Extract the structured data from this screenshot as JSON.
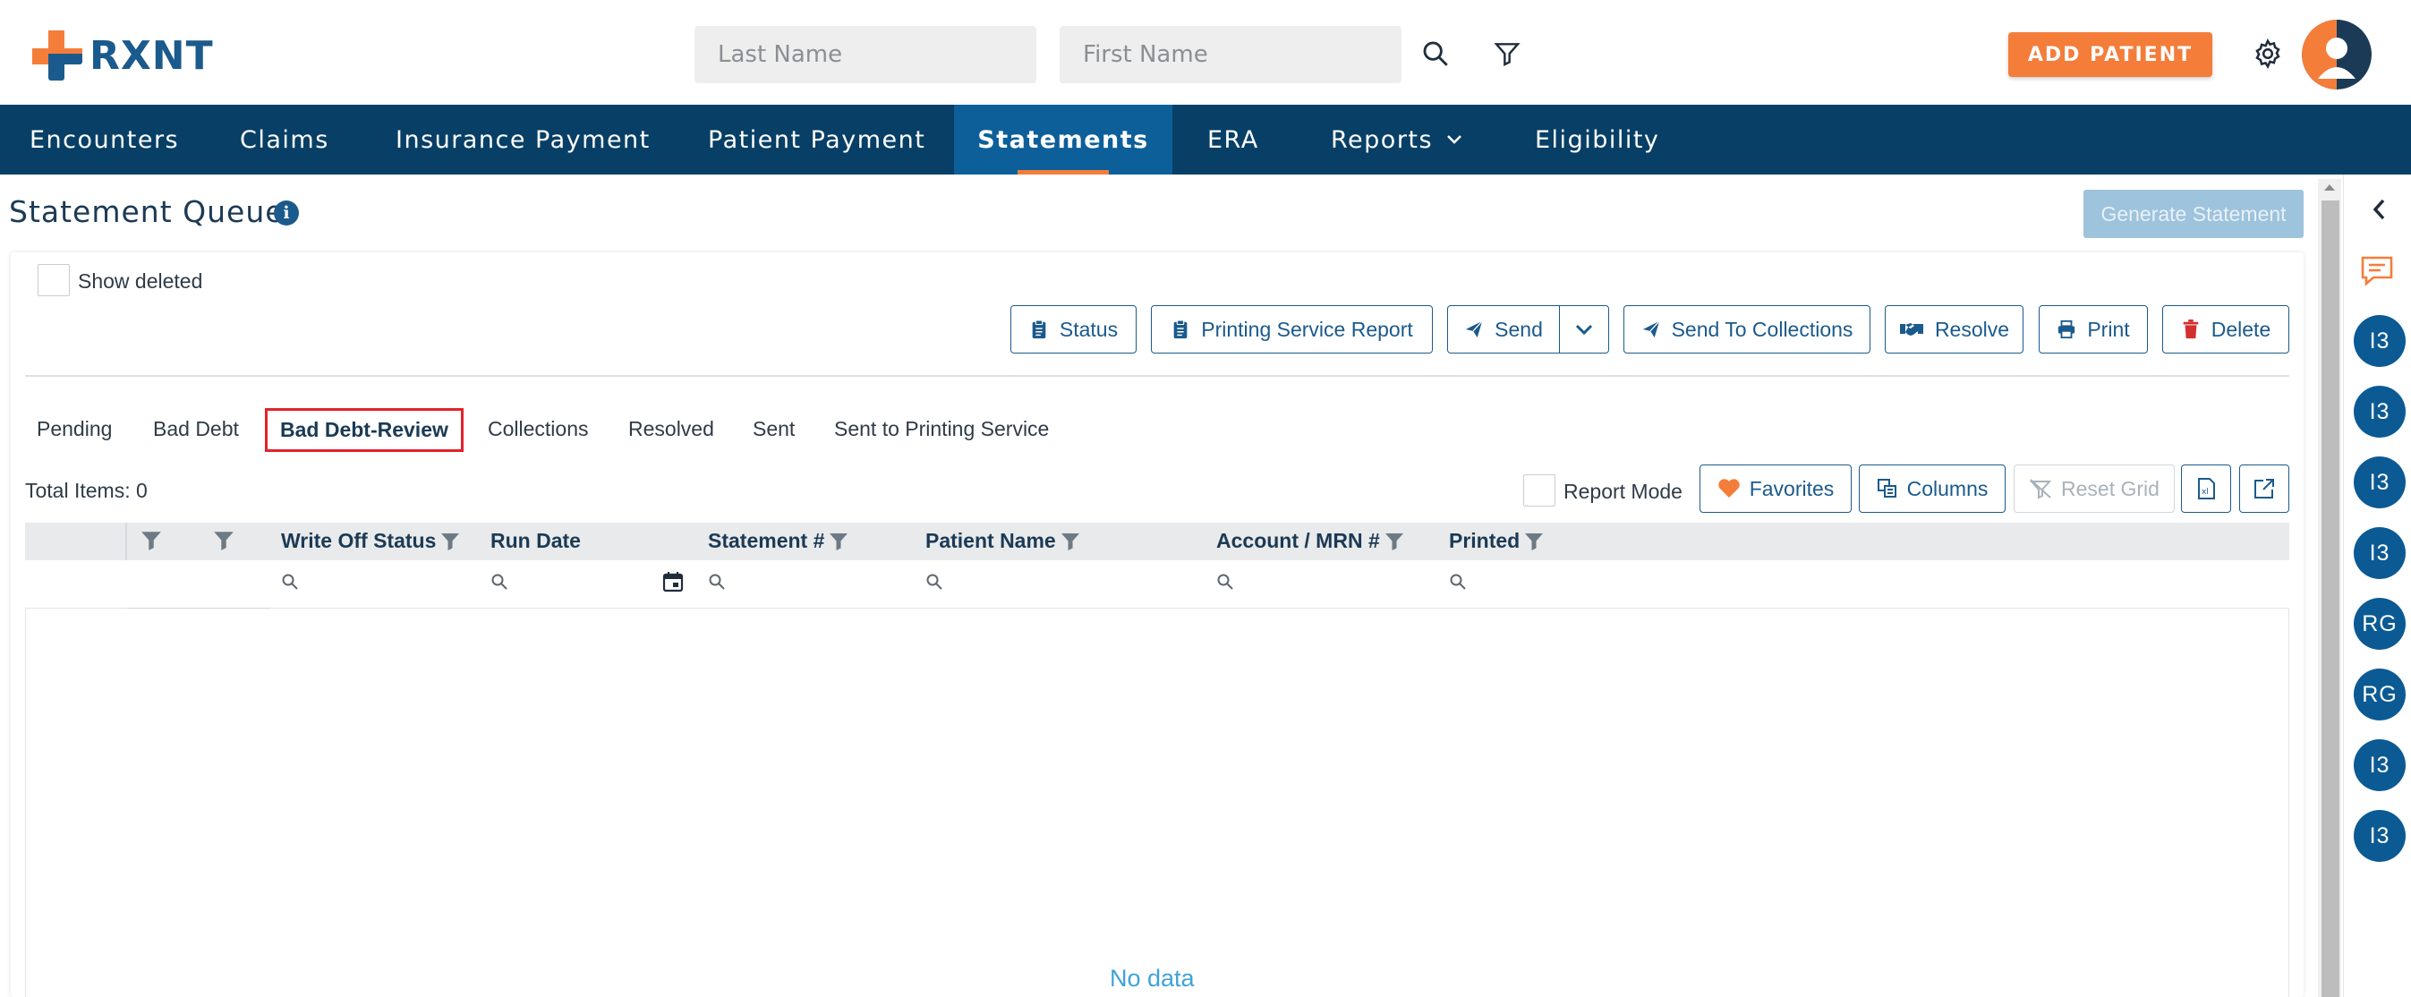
{
  "brand": {
    "name": "RXNT"
  },
  "header": {
    "last_name_placeholder": "Last Name",
    "first_name_placeholder": "First Name",
    "add_patient_label": "ADD PATIENT"
  },
  "nav": {
    "items": [
      {
        "label": "Encounters"
      },
      {
        "label": "Claims"
      },
      {
        "label": "Insurance Payment"
      },
      {
        "label": "Patient Payment"
      },
      {
        "label": "Statements",
        "active": true
      },
      {
        "label": "ERA"
      },
      {
        "label": "Reports"
      },
      {
        "label": "Eligibility"
      }
    ]
  },
  "page": {
    "title": "Statement Queue",
    "info_icon_label": "i",
    "generate_statement_label": "Generate Statement"
  },
  "filters": {
    "show_deleted_label": "Show deleted"
  },
  "toolbar": {
    "status_label": "Status",
    "printing_service_report_label": "Printing Service Report",
    "send_label": "Send",
    "send_to_collections_label": "Send To Collections",
    "resolve_label": "Resolve",
    "print_label": "Print",
    "delete_label": "Delete"
  },
  "tabs": [
    {
      "label": "Pending"
    },
    {
      "label": "Bad Debt"
    },
    {
      "label": "Bad Debt-Review",
      "active": true
    },
    {
      "label": "Collections"
    },
    {
      "label": "Resolved"
    },
    {
      "label": "Sent"
    },
    {
      "label": "Sent to Printing Service"
    }
  ],
  "grid": {
    "total_items_label": "Total Items: 0",
    "report_mode_label": "Report Mode",
    "favorites_label": "Favorites",
    "columns_label": "Columns",
    "reset_grid_label": "Reset Grid",
    "columns": [
      {
        "label": "Write Off Status"
      },
      {
        "label": "Run Date"
      },
      {
        "label": "Statement #"
      },
      {
        "label": "Patient Name"
      },
      {
        "label": "Account / MRN #"
      },
      {
        "label": "Printed"
      }
    ],
    "empty_text": "No data"
  },
  "rail": {
    "avatars": [
      "I3",
      "I3",
      "I3",
      "I3",
      "RG",
      "RG",
      "I3",
      "I3"
    ]
  },
  "colors": {
    "nav_bg": "#073f66",
    "nav_active": "#0d5f9a",
    "accent_orange": "#f47d3a",
    "primary_blue": "#1b5a8c",
    "tab_highlight": "#e2222a"
  }
}
